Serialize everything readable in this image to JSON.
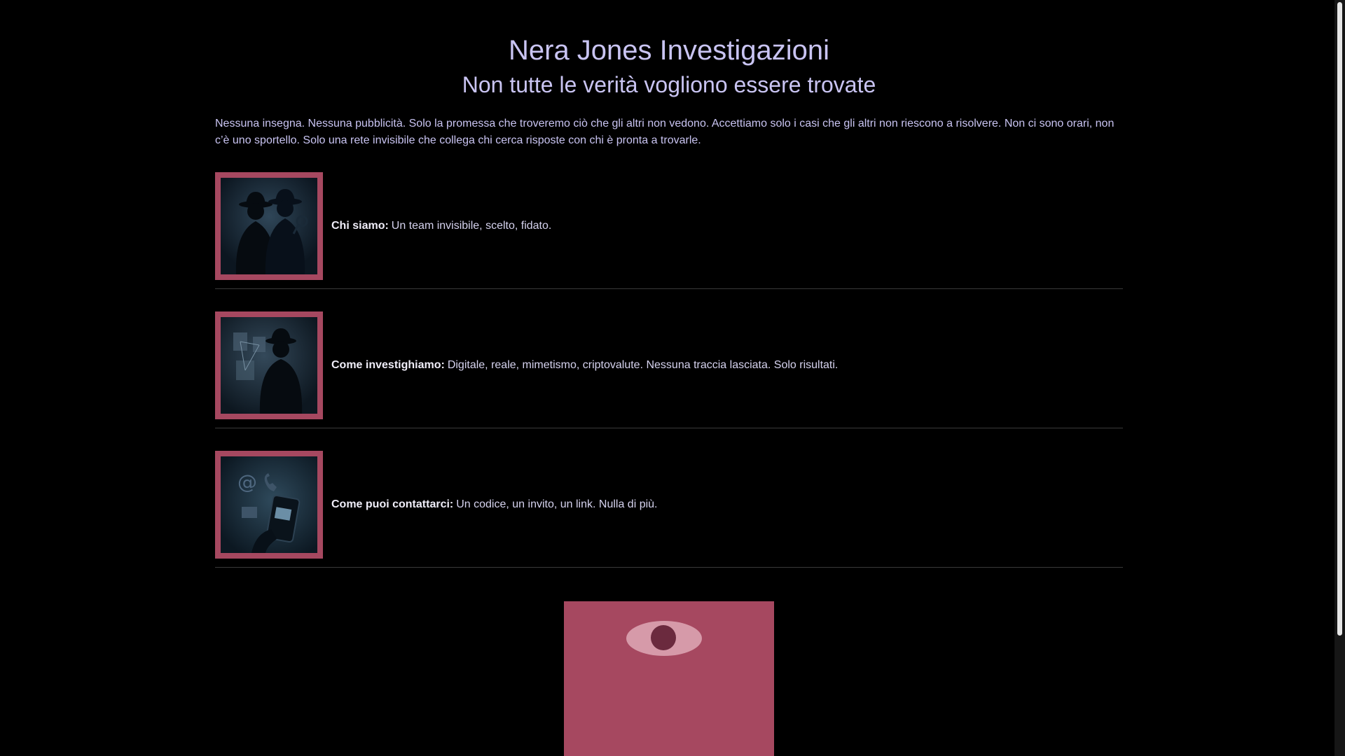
{
  "header": {
    "title": "Nera Jones Investigazioni",
    "subtitle": "Non tutte le verità vogliono essere trovate"
  },
  "intro": "Nessuna insegna. Nessuna pubblicità. Solo la promessa che troveremo ciò che gli altri non vedono. Accettiamo solo i casi che gli altri non riescono a risolvere. Non ci sono orari, non c’è uno sportello. Solo una rete invisibile che collega chi cerca risposte con chi è pronta a trovarle.",
  "sections": [
    {
      "icon": "detectives-silhouette-icon",
      "label": "Chi siamo:",
      "text": "Un team invisibile, scelto, fidato."
    },
    {
      "icon": "investigator-evidence-board-icon",
      "label": "Come investighiamo:",
      "text": "Digitale, reale, mimetismo, criptovalute. Nessuna traccia lasciata. Solo risultati."
    },
    {
      "icon": "phone-contact-icon",
      "label": "Come puoi contattarci:",
      "text": "Un codice, un invito, un link. Nulla di più."
    }
  ],
  "eye_panel": {
    "icon": "eye-icon"
  },
  "colors": {
    "background": "#000000",
    "accent": "#a64860",
    "title": "#c9c4f2",
    "text": "#d6d3ef"
  }
}
